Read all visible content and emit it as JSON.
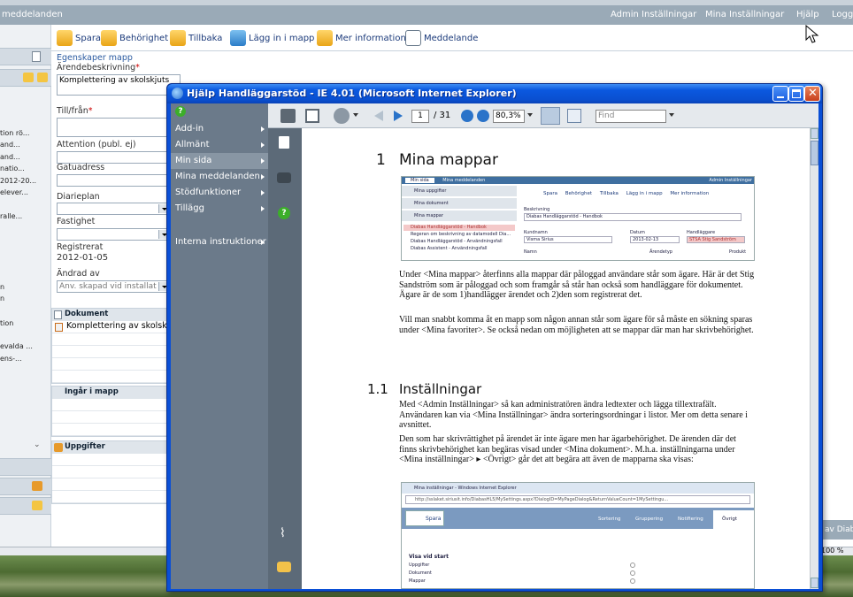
{
  "topbar": {
    "left_title": "meddelanden",
    "admin": "Admin Inställningar",
    "mine": "Mina Inställningar",
    "help": "Hjälp",
    "logout": "Logg"
  },
  "toolbar": {
    "save": "Spara",
    "permission": "Behörighet",
    "back": "Tillbaka",
    "add_to_folder": "Lägg in i mapp",
    "more_info": "Mer information",
    "message": "Meddelande"
  },
  "leftnav": {
    "items": [
      "tion rö...",
      "and...",
      "and...",
      "natio...",
      "2012-20...",
      "elever...",
      "ralle...",
      "n",
      "n",
      "tion",
      "evalda ...",
      "ens-..."
    ]
  },
  "form": {
    "section": "Egenskaper mapp",
    "case_desc_label": "Ärendebeskrivning",
    "case_desc_value": "Komplettering av skolskjuts",
    "tofrom_label": "Till/från",
    "attention_label": "Attention (publ. ej)",
    "street_label": "Gatuadress",
    "diary_label": "Diarieplan",
    "property_label": "Fastighet",
    "registered_label": "Registrerat",
    "registered_value": "2012-01-05",
    "changed_label": "Ändrad av",
    "changed_placeholder": "Anv. skapad vid installat",
    "doc_header": "Dokument",
    "doc_item": "Komplettering av skolskj...",
    "in_folder_header": "Ingår i mapp",
    "tasks_header": "Uppgifter"
  },
  "rightside": {
    "label": "av Diab"
  },
  "status": {
    "zoom": "100 %"
  },
  "popup": {
    "title": "Hjälp Handläggarstöd - IE 4.01 (Microsoft Internet Explorer)",
    "menu": [
      "Add-in",
      "Allmänt",
      "Min sida",
      "Mina meddelanden",
      "Stödfunktioner",
      "Tillägg",
      "Interna instruktioner"
    ],
    "active_menu": "Min sida",
    "pdf": {
      "page": "1",
      "total": "/ 31",
      "zoom": "80,3%",
      "find": "Find"
    },
    "doc": {
      "h1_num": "1",
      "h1": "Mina mappar",
      "p1": "Under <Mina mappar> återfinns alla mappar där påloggad användare står som ägare. Här är det Stig Sandström som är påloggad och som framgår så står han också som handläggare för dokumentet. Ägare är de som 1)handlägger ärendet och 2)den som registrerat det.",
      "p2": "Vill man snabbt komma åt en mapp som någon annan står som ägare för så måste en sökning sparas under <Mina favoriter>. Se också nedan om möjligheten att se mappar där man har skrivbehörighet.",
      "h2_num": "1.1",
      "h2": "Inställningar",
      "p3": "Med <Admin Inställningar> så kan administratören ändra ledtexter och lägga tillextrafält. Användaren kan via <Mina Inställningar> ändra sorteringsordningar i listor. Mer om detta senare i avsnittet.",
      "p4": "Den som har skrivrättighet på ärendet är inte ägare men har ägarbehörighet. De ärenden där det finns skrivbehörighet kan begäras visad under <Mina dokument>. M.h.a. inställningarna under <Mina inställningar> ▸ <Övrigt> går det att begära att även de mapparna ska visas:",
      "shot1": {
        "tab1": "Min sida",
        "tab2": "Mina meddelanden",
        "admin": "Admin Inställningar",
        "nav1": "Mina uppgifter",
        "nav2": "Mina dokument",
        "nav3": "Mina mappar",
        "list1": "Diabas Handläggarstöd - Handbok",
        "list2": "Regeran om beskrivning av datamodell Dia...",
        "list3": "Diabas Handläggarstöd - Användningsfall",
        "list4": "Diabas Assistent - Användningsfall",
        "tb_save": "Spara",
        "tb_perm": "Behörighet",
        "tb_back": "Tillbaka",
        "tb_add": "Lägg in i mapp",
        "tb_info": "Mer information",
        "desc_label": "Beskrivning",
        "desc_value": "Diabas Handläggarstöd - Handbok",
        "customer_label": "Kundnamn",
        "customer_value": "Visma Sirius",
        "date_label": "Datum",
        "date_value": "2013-02-13",
        "handler_label": "Handläggare",
        "handler_value": "STSA Stig Sandström",
        "name_label": "Namn",
        "type_label": "Ärendetyp",
        "product_label": "Produkt"
      },
      "shot2": {
        "title": "Mina inställningar - Windows Internet Explorer",
        "url": "http://sslaket.siriusit.info/DiabasHL5/MySettings.aspx?DialogID=MyPageDialog&ReturnValueCount=1MySettingu...",
        "save": "Spara",
        "tabs": [
          "Sortering",
          "Gruppering",
          "Notifiering",
          "Övrigt"
        ],
        "section": "Visa vid start",
        "rows": [
          "Uppgifter",
          "Dokument",
          "Mappar"
        ]
      }
    }
  },
  "colors": {
    "accent": "#0a4fd6",
    "menu_bg": "#6b7a8a",
    "topbar": "#9aaab7"
  }
}
